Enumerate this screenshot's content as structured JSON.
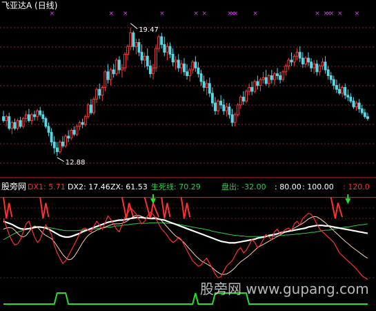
{
  "colors": {
    "background": "#000000",
    "up": "#ff3b3b",
    "down": "#56d9e6",
    "grid": "#9a2a2a",
    "separator": "#cc2020",
    "label": "#ffffff",
    "mark": "#e040fb",
    "dx1": "#ff3030",
    "dx2": "#ffffff",
    "zx": "#ffffff",
    "life": "#24d24a",
    "panchu": "#24d24a",
    "lev80": "#ffffff",
    "lev100": "#ffffff",
    "lev120": "#ff3030",
    "signal": "#24e02a"
  },
  "price_panel": {
    "title": "飞亚达A",
    "period": "(日线)",
    "title_full": "飞亚达A (日线)",
    "high_label": "19.47",
    "low_label": "12.88",
    "high": 19.47,
    "low": 12.88,
    "ylim": [
      12.2,
      20.1
    ]
  },
  "indicator_panel": {
    "name": "股旁网",
    "labels": [
      {
        "key": "dx1",
        "name": "DX1:",
        "value": "5.71"
      },
      {
        "key": "dx2",
        "name": "DX2:",
        "value": "17.46"
      },
      {
        "key": "zx",
        "name": "ZX:",
        "value": "61.53"
      },
      {
        "key": "life",
        "name": "生死线:",
        "value": "70.29"
      },
      {
        "key": "panchu",
        "name": "盘出:",
        "value": "-32.00"
      },
      {
        "key": "lev80",
        "name": ":",
        "value": "80.00"
      },
      {
        "key": "lev100",
        "name": ":",
        "value": "100.00"
      },
      {
        "key": "lev120",
        "name": ":",
        "value": "120.0"
      }
    ],
    "ylim": [
      -40,
      130
    ]
  },
  "watermark": "股旁网 www.gupang.com",
  "chart_data": {
    "type": "candlestick",
    "title": "飞亚达A (日线)",
    "n_bars": 130,
    "candles": [
      [
        14.9,
        15.2,
        14.6,
        14.7
      ],
      [
        14.7,
        15.0,
        14.4,
        14.9
      ],
      [
        14.9,
        15.1,
        14.2,
        14.3
      ],
      [
        14.3,
        14.7,
        14.0,
        14.6
      ],
      [
        14.6,
        14.8,
        14.2,
        14.3
      ],
      [
        14.3,
        14.8,
        14.2,
        14.7
      ],
      [
        14.7,
        14.9,
        14.3,
        14.4
      ],
      [
        14.4,
        14.9,
        14.3,
        14.8
      ],
      [
        14.8,
        15.2,
        14.6,
        15.0
      ],
      [
        15.0,
        15.3,
        14.6,
        14.7
      ],
      [
        14.7,
        15.1,
        14.5,
        15.0
      ],
      [
        15.0,
        15.2,
        14.7,
        14.9
      ],
      [
        14.9,
        15.3,
        14.7,
        15.2
      ],
      [
        15.2,
        15.4,
        14.9,
        15.0
      ],
      [
        15.0,
        15.2,
        14.6,
        14.8
      ],
      [
        14.8,
        14.9,
        14.3,
        14.4
      ],
      [
        14.4,
        14.6,
        13.9,
        14.1
      ],
      [
        14.1,
        14.3,
        13.4,
        13.6
      ],
      [
        13.6,
        13.9,
        13.0,
        13.3
      ],
      [
        13.3,
        13.6,
        12.88,
        13.1
      ],
      [
        13.1,
        13.7,
        13.0,
        13.6
      ],
      [
        13.6,
        13.9,
        13.3,
        13.4
      ],
      [
        13.4,
        14.0,
        13.3,
        13.9
      ],
      [
        13.9,
        14.2,
        13.6,
        13.8
      ],
      [
        13.8,
        14.3,
        13.7,
        14.2
      ],
      [
        14.2,
        14.4,
        13.9,
        14.0
      ],
      [
        14.0,
        14.5,
        13.9,
        14.4
      ],
      [
        14.4,
        14.7,
        14.2,
        14.6
      ],
      [
        14.6,
        14.8,
        14.3,
        14.5
      ],
      [
        14.5,
        15.0,
        14.4,
        14.9
      ],
      [
        14.9,
        15.6,
        14.8,
        15.5
      ],
      [
        15.5,
        15.8,
        15.0,
        15.1
      ],
      [
        15.1,
        15.9,
        15.0,
        15.8
      ],
      [
        15.8,
        16.4,
        15.6,
        16.3
      ],
      [
        16.3,
        16.6,
        15.8,
        16.0
      ],
      [
        16.0,
        16.5,
        15.7,
        16.4
      ],
      [
        16.4,
        17.3,
        16.2,
        17.2
      ],
      [
        17.2,
        17.6,
        16.6,
        16.8
      ],
      [
        16.8,
        17.4,
        16.5,
        17.3
      ],
      [
        17.3,
        17.6,
        16.9,
        17.1
      ],
      [
        17.1,
        17.9,
        17.0,
        17.8
      ],
      [
        17.8,
        18.0,
        17.1,
        17.3
      ],
      [
        17.3,
        17.6,
        16.9,
        17.4
      ],
      [
        17.4,
        18.2,
        17.2,
        18.1
      ],
      [
        18.1,
        18.6,
        17.8,
        18.5
      ],
      [
        18.5,
        19.47,
        18.3,
        19.2
      ],
      [
        19.2,
        19.3,
        18.3,
        18.5
      ],
      [
        18.5,
        18.9,
        18.1,
        18.7
      ],
      [
        18.7,
        18.9,
        18.0,
        18.2
      ],
      [
        18.2,
        18.6,
        17.6,
        17.8
      ],
      [
        17.8,
        18.2,
        17.4,
        18.0
      ],
      [
        18.0,
        18.4,
        17.3,
        17.5
      ],
      [
        17.5,
        17.8,
        16.9,
        17.1
      ],
      [
        17.1,
        17.6,
        16.8,
        17.4
      ],
      [
        17.4,
        18.6,
        17.2,
        18.4
      ],
      [
        18.4,
        19.1,
        18.2,
        19.0
      ],
      [
        19.0,
        19.2,
        18.4,
        18.6
      ],
      [
        18.6,
        19.0,
        18.0,
        18.2
      ],
      [
        18.2,
        18.7,
        17.8,
        18.5
      ],
      [
        18.5,
        18.7,
        17.9,
        18.1
      ],
      [
        18.1,
        18.4,
        17.5,
        17.7
      ],
      [
        17.7,
        18.0,
        17.3,
        17.8
      ],
      [
        17.8,
        18.1,
        17.2,
        17.4
      ],
      [
        17.4,
        17.8,
        17.1,
        17.6
      ],
      [
        17.6,
        17.9,
        17.0,
        17.2
      ],
      [
        17.2,
        17.6,
        16.8,
        17.0
      ],
      [
        17.0,
        17.4,
        16.7,
        17.3
      ],
      [
        17.3,
        17.8,
        17.1,
        17.7
      ],
      [
        17.7,
        18.0,
        17.2,
        17.4
      ],
      [
        17.4,
        17.7,
        16.9,
        17.1
      ],
      [
        17.1,
        17.3,
        16.5,
        16.7
      ],
      [
        16.7,
        17.0,
        16.2,
        16.4
      ],
      [
        16.4,
        16.8,
        16.0,
        16.6
      ],
      [
        16.6,
        16.9,
        15.9,
        16.1
      ],
      [
        16.1,
        16.4,
        15.4,
        15.6
      ],
      [
        15.6,
        15.9,
        15.0,
        15.2
      ],
      [
        15.2,
        15.8,
        15.0,
        15.7
      ],
      [
        15.7,
        16.0,
        15.3,
        15.5
      ],
      [
        15.5,
        15.8,
        15.0,
        15.2
      ],
      [
        15.2,
        15.6,
        14.9,
        15.4
      ],
      [
        15.4,
        15.6,
        14.8,
        15.0
      ],
      [
        15.0,
        15.3,
        14.4,
        14.6
      ],
      [
        14.6,
        15.1,
        14.4,
        15.0
      ],
      [
        15.0,
        15.6,
        14.9,
        15.5
      ],
      [
        15.5,
        16.0,
        15.3,
        15.9
      ],
      [
        15.9,
        16.2,
        15.5,
        15.7
      ],
      [
        15.7,
        16.3,
        15.6,
        16.2
      ],
      [
        16.2,
        16.6,
        16.0,
        16.4
      ],
      [
        16.4,
        16.7,
        16.0,
        16.2
      ],
      [
        16.2,
        16.8,
        16.1,
        16.7
      ],
      [
        16.7,
        17.0,
        16.3,
        16.5
      ],
      [
        16.5,
        16.9,
        16.2,
        16.8
      ],
      [
        16.8,
        17.2,
        16.6,
        16.9
      ],
      [
        16.9,
        17.3,
        16.5,
        16.6
      ],
      [
        16.6,
        17.1,
        16.4,
        17.0
      ],
      [
        17.0,
        17.3,
        16.6,
        16.8
      ],
      [
        16.8,
        17.2,
        16.5,
        17.1
      ],
      [
        17.1,
        17.4,
        16.8,
        17.0
      ],
      [
        17.0,
        17.2,
        16.6,
        16.8
      ],
      [
        16.8,
        17.3,
        16.7,
        17.2
      ],
      [
        17.2,
        17.6,
        17.0,
        17.5
      ],
      [
        17.5,
        17.9,
        17.3,
        17.8
      ],
      [
        17.8,
        18.2,
        17.5,
        17.7
      ],
      [
        17.7,
        18.1,
        17.5,
        18.0
      ],
      [
        18.0,
        18.4,
        17.8,
        18.2
      ],
      [
        18.2,
        18.5,
        17.7,
        17.9
      ],
      [
        17.9,
        18.2,
        17.4,
        17.6
      ],
      [
        17.6,
        18.0,
        17.4,
        17.9
      ],
      [
        17.9,
        18.2,
        17.5,
        17.7
      ],
      [
        17.7,
        17.9,
        17.2,
        17.4
      ],
      [
        17.4,
        17.8,
        17.1,
        17.6
      ],
      [
        17.6,
        17.8,
        17.0,
        17.2
      ],
      [
        17.2,
        17.6,
        17.0,
        17.5
      ],
      [
        17.5,
        17.9,
        17.3,
        17.7
      ],
      [
        17.7,
        18.0,
        17.1,
        17.3
      ],
      [
        17.3,
        17.5,
        16.8,
        17.0
      ],
      [
        17.0,
        17.2,
        16.6,
        16.8
      ],
      [
        16.8,
        17.0,
        16.3,
        16.5
      ],
      [
        16.5,
        16.8,
        16.1,
        16.3
      ],
      [
        16.3,
        16.6,
        16.0,
        16.1
      ],
      [
        16.1,
        16.5,
        15.9,
        16.4
      ],
      [
        16.4,
        16.6,
        15.8,
        16.0
      ],
      [
        16.0,
        16.3,
        15.7,
        15.9
      ],
      [
        15.9,
        16.1,
        15.6,
        15.7
      ],
      [
        15.7,
        15.9,
        15.3,
        15.4
      ],
      [
        15.4,
        15.7,
        15.2,
        15.6
      ],
      [
        15.6,
        15.8,
        15.1,
        15.3
      ],
      [
        15.3,
        15.5,
        15.0,
        15.1
      ],
      [
        15.1,
        15.3,
        14.8,
        14.9
      ],
      [
        14.9,
        15.1,
        14.7,
        14.8
      ]
    ],
    "top_marks": [
      17,
      38,
      43,
      56,
      68,
      71,
      80,
      81,
      82,
      89,
      111,
      114,
      115,
      116,
      119,
      125
    ],
    "indicator": {
      "dx1": [
        80,
        65,
        50,
        38,
        30,
        32,
        40,
        55,
        70,
        75,
        60,
        45,
        35,
        40,
        55,
        68,
        60,
        50,
        30,
        15,
        5,
        -5,
        0,
        10,
        20,
        30,
        40,
        52,
        60,
        62,
        58,
        55,
        65,
        75,
        68,
        60,
        72,
        85,
        78,
        70,
        60,
        55,
        68,
        82,
        90,
        100,
        95,
        88,
        78,
        70,
        75,
        85,
        92,
        88,
        80,
        70,
        60,
        55,
        48,
        40,
        35,
        38,
        45,
        40,
        30,
        20,
        10,
        0,
        -5,
        -10,
        -8,
        0,
        5,
        -5,
        -15,
        -25,
        -32,
        -30,
        -20,
        -10,
        -5,
        0,
        10,
        20,
        25,
        15,
        20,
        30,
        40,
        35,
        25,
        30,
        40,
        50,
        45,
        40,
        55,
        60,
        50,
        55,
        60,
        62,
        58,
        70,
        75,
        68,
        80,
        85,
        90,
        88,
        80,
        70,
        60,
        55,
        50,
        45,
        40,
        35,
        25,
        15,
        10,
        5,
        0,
        -5,
        -10,
        -15,
        -22,
        -28,
        -32,
        -35
      ],
      "dx2": [
        60,
        62,
        63,
        62,
        58,
        52,
        47,
        45,
        48,
        55,
        62,
        66,
        64,
        58,
        52,
        48,
        45,
        42,
        36,
        28,
        20,
        12,
        6,
        2,
        3,
        8,
        16,
        25,
        34,
        42,
        48,
        52,
        55,
        58,
        60,
        62,
        64,
        66,
        68,
        70,
        70,
        70,
        71,
        73,
        76,
        80,
        84,
        86,
        86,
        84,
        82,
        80,
        80,
        82,
        82,
        80,
        76,
        70,
        64,
        58,
        52,
        47,
        43,
        39,
        34,
        28,
        22,
        16,
        10,
        5,
        0,
        -3,
        -6,
        -9,
        -13,
        -18,
        -22,
        -25,
        -26,
        -25,
        -22,
        -18,
        -13,
        -7,
        -2,
        2,
        6,
        10,
        15,
        20,
        25,
        28,
        31,
        34,
        37,
        40,
        43,
        46,
        49,
        52,
        55,
        57,
        59,
        62,
        65,
        68,
        71,
        75,
        79,
        82,
        84,
        83,
        80,
        76,
        72,
        67,
        62,
        57,
        52,
        47,
        42,
        37,
        33,
        28,
        24,
        20,
        16,
        12,
        8,
        5
      ],
      "zx": [
        75,
        73,
        71,
        69,
        66,
        63,
        61,
        60,
        60,
        61,
        62,
        63,
        64,
        64,
        63,
        62,
        60,
        57,
        54,
        51,
        48,
        46,
        45,
        45,
        46,
        48,
        50,
        52,
        55,
        57,
        59,
        61,
        63,
        65,
        67,
        69,
        71,
        73,
        74,
        75,
        76,
        77,
        77,
        78,
        79,
        80,
        81,
        82,
        82,
        82,
        81,
        81,
        80,
        80,
        80,
        79,
        78,
        77,
        75,
        73,
        71,
        69,
        67,
        65,
        63,
        61,
        59,
        57,
        55,
        53,
        51,
        49,
        47,
        45,
        43,
        41,
        39,
        37,
        36,
        35,
        34,
        34,
        34,
        35,
        36,
        37,
        38,
        39,
        40,
        41,
        43,
        44,
        45,
        46,
        48,
        49,
        50,
        51,
        53,
        54,
        55,
        56,
        57,
        58,
        59,
        60,
        61,
        62,
        64,
        65,
        66,
        67,
        67,
        67,
        66,
        66,
        65,
        64,
        63,
        62,
        61,
        60,
        59,
        58,
        57,
        56,
        55,
        54,
        53,
        52
      ],
      "life": [
        40,
        43,
        46,
        49,
        52,
        54,
        56,
        58,
        60,
        61,
        62,
        63,
        64,
        64,
        64,
        64,
        63,
        62,
        61,
        60,
        59,
        58,
        57,
        57,
        57,
        57,
        57,
        58,
        58,
        59,
        59,
        60,
        60,
        61,
        62,
        62,
        63,
        64,
        64,
        65,
        66,
        66,
        67,
        68,
        68,
        69,
        70,
        70,
        71,
        71,
        71,
        71,
        72,
        72,
        72,
        72,
        72,
        72,
        71,
        71,
        70,
        70,
        69,
        68,
        67,
        66,
        65,
        64,
        63,
        62,
        61,
        60,
        59,
        58,
        56,
        55,
        54,
        53,
        52,
        51,
        50,
        49,
        48,
        48,
        47,
        47,
        46,
        46,
        46,
        46,
        46,
        46,
        46,
        46,
        46,
        47,
        47,
        47,
        48,
        48,
        49,
        49,
        50,
        50,
        51,
        51,
        52,
        52,
        53,
        54,
        54,
        55,
        56,
        57,
        58,
        58,
        59,
        60,
        61,
        62,
        63,
        64,
        64,
        65,
        66,
        67,
        68,
        68,
        69,
        70
      ],
      "signal": [
        0,
        0,
        0,
        0,
        0,
        0,
        0,
        0,
        0,
        0,
        0,
        0,
        0,
        0,
        0,
        0,
        0,
        0,
        0,
        1,
        1,
        1,
        1,
        0,
        0,
        0,
        0,
        0,
        0,
        0,
        0,
        0,
        0,
        0,
        0,
        0,
        0,
        0,
        0,
        0,
        0,
        0,
        0,
        0,
        0,
        0,
        0,
        0,
        0,
        0,
        0,
        0,
        0,
        0,
        0,
        0,
        0,
        0,
        0,
        0,
        0,
        0,
        0,
        0,
        0,
        0,
        0,
        0,
        1,
        0,
        0,
        0,
        0,
        0,
        0,
        1,
        1,
        1,
        1,
        1,
        1,
        1,
        1,
        1,
        1,
        1,
        1,
        0,
        0,
        0,
        0,
        0,
        0,
        0,
        0,
        0,
        0,
        0,
        0,
        0,
        0,
        0,
        0,
        0,
        0,
        0,
        0,
        0,
        0,
        0,
        0,
        0,
        0,
        0,
        0,
        0,
        0,
        0,
        0,
        0,
        0,
        0,
        0,
        0,
        0,
        0,
        0,
        0,
        0,
        0
      ],
      "levels": [
        -32,
        80,
        100,
        120
      ],
      "down_arrows": [
        53,
        122
      ],
      "lightning_ranges": [
        [
          0,
          3
        ],
        [
          13,
          16
        ],
        [
          42,
          46
        ],
        [
          50,
          55
        ],
        [
          56,
          59
        ],
        [
          63,
          66
        ],
        [
          116,
          120
        ]
      ]
    }
  }
}
